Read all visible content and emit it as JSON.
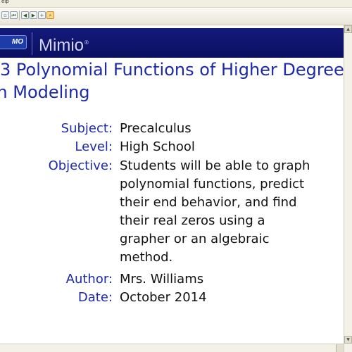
{
  "menubar": {
    "item": "elp"
  },
  "banner": {
    "badge": "MO",
    "brand": "Mimio",
    "brand_mark": "®"
  },
  "slide": {
    "title_line1": "3 Polynomial Functions of Higher Degree",
    "title_line2": "th Modeling",
    "subject_label": "Subject:",
    "subject_value": "Precalculus",
    "level_label": "Level:",
    "level_value": "High School",
    "objective_label": "Objective:",
    "objective_lines": [
      "Students will be able to graph",
      "polynomial functions, predict",
      "their end behavior, and find",
      "their real zeros using a",
      "grapher or an algebraic",
      "method."
    ],
    "author_label": "Author:",
    "author_value": "Mrs. Williams",
    "date_label": "Date:",
    "date_value": "October 2014"
  },
  "colors": {
    "accent": "#1c2aa8",
    "banner": "#0a0f62",
    "brand_text": "#d4d7ff"
  }
}
